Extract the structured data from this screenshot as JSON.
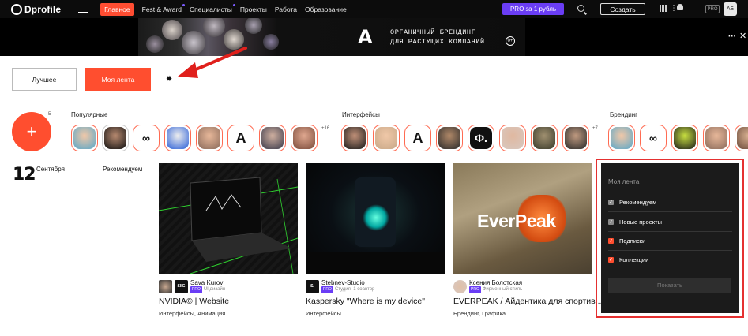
{
  "brand": {
    "name": "Dprofile"
  },
  "nav": {
    "items": [
      {
        "label": "Главное",
        "active": true
      },
      {
        "label": "Fest & Award",
        "dot": true
      },
      {
        "label": "Специалисты",
        "dot": true
      },
      {
        "label": "Проекты"
      },
      {
        "label": "Работа"
      },
      {
        "label": "Образование"
      }
    ],
    "pro_label": "PRO за 1 рубль",
    "create_label": "Создать",
    "pro_badge": "PRO",
    "user_initials": "АБ"
  },
  "banner": {
    "logo": "A",
    "line1": "ОРГАНИЧНЫЙ БРЕНДИНГ",
    "line2": "ДЛЯ РАСТУЩИХ КОМПАНИЙ",
    "age": "0+"
  },
  "feed_controls": {
    "best_label": "Лучшее",
    "my_feed_label": "Моя лента"
  },
  "stories": {
    "plus_count": "5",
    "groups": [
      {
        "label": "Популярные",
        "more": "+16"
      },
      {
        "label": "Интерфейсы",
        "more": "+7"
      },
      {
        "label": "Брендинг",
        "more": ""
      }
    ]
  },
  "date": {
    "day": "12",
    "month": "Сентября",
    "section": "Рекомендуем"
  },
  "cards": [
    {
      "author": "Sava Kurov",
      "avatar2": "SIIG",
      "pro": "PRO",
      "sub": "UI дизайн",
      "title": "NVIDIA© | Website",
      "tags": "Интерфейсы, Анимация"
    },
    {
      "author": "Stebnev-Studio",
      "avatar": "S/",
      "pro": "PRO",
      "sub": "Студия, 1 соавтор",
      "title": "Kaspersky \"Where is my device\"",
      "tags": "Интерфейсы"
    },
    {
      "author": "Ксения Болотская",
      "pro": "PRO",
      "sub": "Фирменный стиль",
      "title": "EVERPEAK / Айдентика для спортив...",
      "tags": "Брендинг, Графика",
      "thumb_text": "EverPeak"
    }
  ],
  "feed_menu": {
    "title": "Моя лента",
    "options": [
      {
        "label": "Рекомендуем",
        "style": "grey"
      },
      {
        "label": "Новые проекты",
        "style": "grey"
      },
      {
        "label": "Подписки",
        "style": "red"
      },
      {
        "label": "Коллекции",
        "style": "red"
      }
    ],
    "show_label": "Показать"
  },
  "colors": {
    "accent": "#ff4e2f",
    "pro": "#6a3df5",
    "highlight": "#e53030",
    "panel": "#1b1b1b"
  }
}
